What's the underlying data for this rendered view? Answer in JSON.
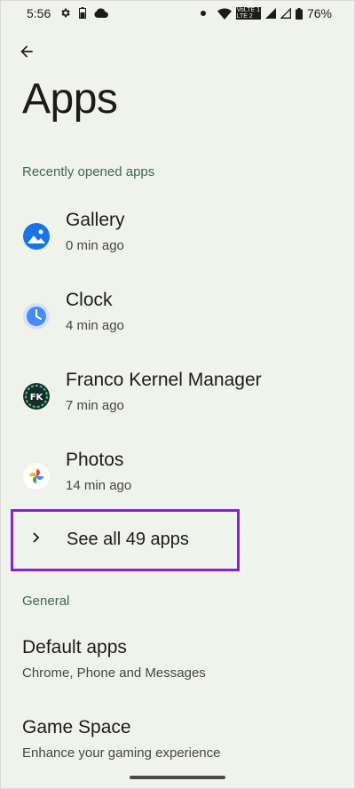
{
  "status_bar": {
    "time": "5:56",
    "network_label_top": "VoLTE 1",
    "network_label_bottom": "LTE 2",
    "battery_percent": "76%",
    "icons": [
      "gear-icon",
      "battery-saver-icon",
      "cloud-icon",
      "dot-icon",
      "wifi-icon",
      "signal-icon",
      "signal-icon",
      "battery-icon"
    ]
  },
  "header": {
    "back_icon": "arrow-back-icon",
    "title": "Apps"
  },
  "recent": {
    "section_label": "Recently opened apps",
    "apps": [
      {
        "name": "Gallery",
        "time": "0 min ago",
        "icon": "gallery-icon"
      },
      {
        "name": "Clock",
        "time": "4 min ago",
        "icon": "clock-icon"
      },
      {
        "name": "Franco Kernel Manager",
        "time": "7 min ago",
        "icon": "franco-kernel-icon"
      },
      {
        "name": "Photos",
        "time": "14 min ago",
        "icon": "photos-icon"
      }
    ],
    "see_all_label": "See all 49 apps",
    "highlight_color": "#8a1fd6"
  },
  "general": {
    "section_label": "General",
    "items": [
      {
        "title": "Default apps",
        "subtitle": "Chrome, Phone and Messages"
      },
      {
        "title": "Game Space",
        "subtitle": "Enhance your gaming experience"
      }
    ]
  },
  "colors": {
    "background": "#f0f2ec",
    "section_label": "#3c6b4f"
  }
}
